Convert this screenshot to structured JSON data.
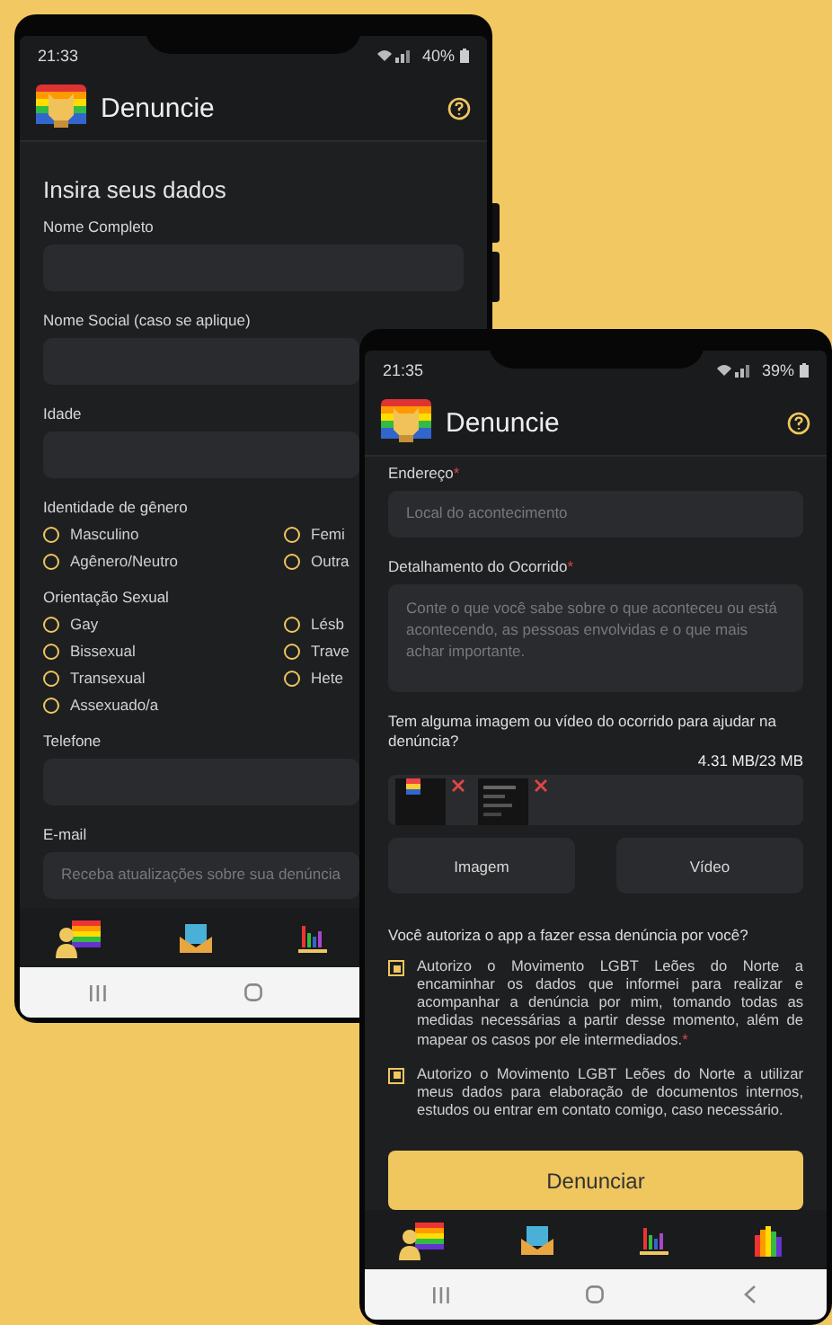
{
  "phone_1": {
    "status_bar": {
      "time": "21:33",
      "battery": "40%"
    },
    "header": {
      "title": "Denuncie"
    },
    "heading": "Insira seus dados",
    "form": [
      {
        "kind": "field",
        "label": "Nome Completo"
      },
      {
        "kind": "field",
        "label": "Nome Social (caso se aplique)"
      },
      {
        "kind": "field",
        "label": "Idade"
      },
      {
        "kind": "radio_group",
        "label": "Identidade de gênero",
        "options": [
          {
            "label": "Masculino",
            "selected": false
          },
          {
            "label": "Femi",
            "selected": false
          },
          {
            "label": "Agênero/Neutro",
            "selected": false
          },
          {
            "label": "Outra",
            "selected": false
          }
        ]
      },
      {
        "kind": "radio_group",
        "label": "Orientação Sexual",
        "options": [
          {
            "label": "Gay",
            "selected": false
          },
          {
            "label": "Lésb",
            "selected": false
          },
          {
            "label": "Bissexual",
            "selected": false
          },
          {
            "label": "Trave",
            "selected": false
          },
          {
            "label": "Transexual",
            "selected": false
          },
          {
            "label": "Hete",
            "selected": false
          },
          {
            "label": "Assexuado/a",
            "selected": false
          }
        ]
      },
      {
        "kind": "field",
        "label": "Telefone"
      },
      {
        "kind": "field",
        "label": "E-mail",
        "placeholder": "Receba atualizações sobre sua denúncia"
      }
    ]
  },
  "phone_2": {
    "status_bar": {
      "time": "21:35",
      "battery": "39%"
    },
    "header": {
      "title": "Denuncie"
    },
    "form": [
      {
        "kind": "field",
        "label": "Endereço",
        "required_mark": "*",
        "placeholder": "Local do acontecimento"
      },
      {
        "kind": "textarea",
        "label": "Detalhamento do Ocorrido",
        "required_mark": "*",
        "placeholder": "Conte o que você sabe sobre o que aconteceu ou está acontecendo, as pessoas envolvidas e o que mais achar importante."
      }
    ],
    "upload": {
      "question": "Tem alguma imagem ou vídeo do ocorrido para ajudar na denúncia?",
      "size": "4.31 MB/23 MB",
      "buttons": [
        "Imagem",
        "Vídeo"
      ]
    },
    "consent": {
      "question": "Você autoriza o app a fazer essa denúncia por você?",
      "options": [
        {
          "text": "Autorizo o Movimento LGBT Leões do Norte a encaminhar os dados que informei para realizar e acompanhar a denúncia por mim, tomando todas as medidas necessárias a partir desse momento, além de mapear os casos por ele intermediados.",
          "required_mark": "*",
          "checked": true
        },
        {
          "text": "Autorizo o Movimento LGBT Leões do Norte a utilizar meus dados para elaboração de documentos internos, estudos ou entrar em contato comigo, caso necessário.",
          "checked": true
        }
      ]
    },
    "submit": "Denunciar"
  }
}
